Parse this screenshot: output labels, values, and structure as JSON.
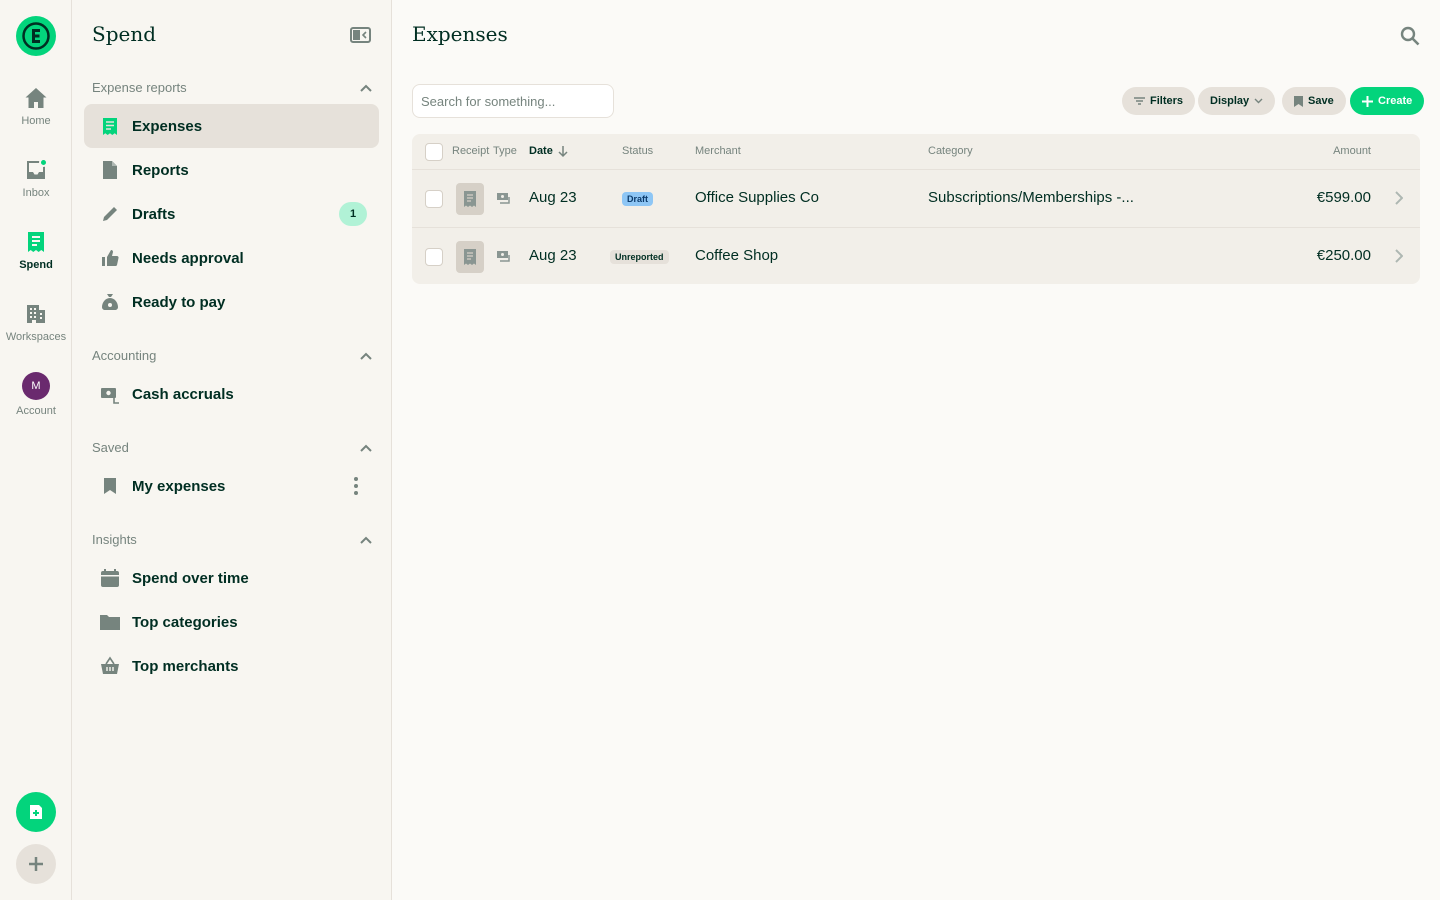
{
  "rail": {
    "home_label": "Home",
    "inbox_label": "Inbox",
    "spend_label": "Spend",
    "workspaces_label": "Workspaces",
    "account_label": "Account",
    "account_initial": "M"
  },
  "sidebar": {
    "title": "Spend",
    "sections": {
      "expense_reports": "Expense reports",
      "accounting": "Accounting",
      "saved": "Saved",
      "insights": "Insights"
    },
    "items": {
      "expenses": "Expenses",
      "reports": "Reports",
      "drafts": "Drafts",
      "drafts_badge": "1",
      "needs_approval": "Needs approval",
      "ready_to_pay": "Ready to pay",
      "cash_accruals": "Cash accruals",
      "my_expenses": "My expenses",
      "spend_over_time": "Spend over time",
      "top_categories": "Top categories",
      "top_merchants": "Top merchants"
    }
  },
  "main": {
    "title": "Expenses",
    "search_placeholder": "Search for something...",
    "toolbar": {
      "filters": "Filters",
      "display": "Display",
      "save": "Save",
      "create": "Create"
    },
    "columns": {
      "receipt": "Receipt",
      "type": "Type",
      "date": "Date",
      "status": "Status",
      "merchant": "Merchant",
      "category": "Category",
      "amount": "Amount"
    },
    "rows": [
      {
        "date": "Aug 23",
        "status": "Draft",
        "merchant": "Office Supplies Co",
        "category": "Subscriptions/Memberships -...",
        "amount": "€599.00"
      },
      {
        "date": "Aug 23",
        "status": "Unreported",
        "merchant": "Coffee Shop",
        "category": "",
        "amount": "€250.00"
      }
    ]
  },
  "colors": {
    "accent": "#03d47c",
    "draft_badge": "#8ec6f5",
    "unreported_badge": "#e6e1da",
    "avatar": "#6a2a6e"
  }
}
